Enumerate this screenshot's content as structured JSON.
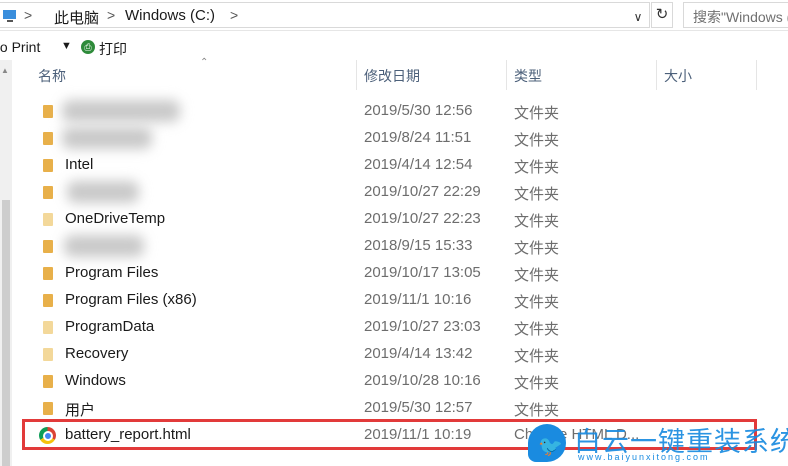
{
  "address_bar": {
    "crumbs": [
      "此电脑",
      "Windows (C:)"
    ],
    "separator": ">",
    "dropdown": "∨",
    "refresh": "↻",
    "search_placeholder": "搜索\"Windows (C:)\""
  },
  "toolbar": {
    "print_label": "to Print",
    "print_arrow": "▼",
    "print_cn": "打印"
  },
  "columns": {
    "name": "名称",
    "date": "修改日期",
    "type": "类型",
    "size": "大小"
  },
  "files": [
    {
      "name": "",
      "date": "2019/5/30 12:56",
      "type": "文件夹",
      "blurred": true
    },
    {
      "name": "",
      "date": "2019/8/24 11:51",
      "type": "文件夹",
      "blurred": true
    },
    {
      "name": "Intel",
      "date": "2019/4/14 12:54",
      "type": "文件夹"
    },
    {
      "name": "",
      "date": "2019/10/27 22:29",
      "type": "文件夹",
      "blurred": true
    },
    {
      "name": "OneDriveTemp",
      "date": "2019/10/27 22:23",
      "type": "文件夹"
    },
    {
      "name": "",
      "date": "2018/9/15 15:33",
      "type": "文件夹",
      "blurred": true
    },
    {
      "name": "Program Files",
      "date": "2019/10/17 13:05",
      "type": "文件夹"
    },
    {
      "name": "Program Files (x86)",
      "date": "2019/11/1 10:16",
      "type": "文件夹"
    },
    {
      "name": "ProgramData",
      "date": "2019/10/27 23:03",
      "type": "文件夹"
    },
    {
      "name": "Recovery",
      "date": "2019/4/14 13:42",
      "type": "文件夹"
    },
    {
      "name": "Windows",
      "date": "2019/10/28 10:16",
      "type": "文件夹"
    },
    {
      "name": "用户",
      "date": "2019/5/30 12:57",
      "type": "文件夹"
    },
    {
      "name": "battery_report.html",
      "date": "2019/11/1 10:19",
      "type": "Chrome HTML D..."
    }
  ],
  "watermark": {
    "title": "白云一键重装系统",
    "url": "www.baiyunxitong.com"
  },
  "colors": {
    "highlight": "#e23a3a",
    "header_text": "#4c607a",
    "folder": "#e8b04a",
    "brand": "#1a8be0"
  }
}
